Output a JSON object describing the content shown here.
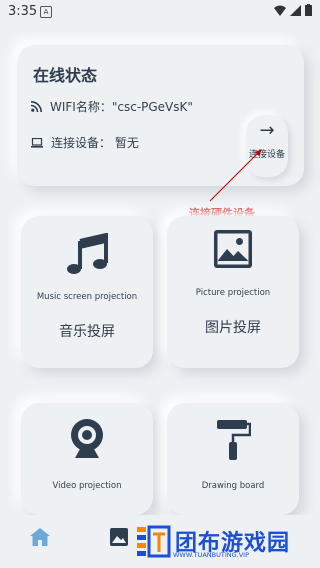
{
  "status_bar": {
    "time": "3:35",
    "app_icon": "A"
  },
  "status_card": {
    "title": "在线状态",
    "wifi_label": "WIFI名称：\"csc-PGeVsK\"",
    "device_label": "连接设备： 暂无",
    "connect_button": "连接设备"
  },
  "annotation": {
    "text": "连接硬件设备",
    "color": "#c40000"
  },
  "tiles": {
    "music": {
      "en": "Music screen projection",
      "cn": "音乐投屏"
    },
    "picture": {
      "en": "Picture projection",
      "cn": "图片投屏"
    },
    "video": {
      "en": "Video projection"
    },
    "drawing": {
      "en": "Drawing board"
    }
  },
  "watermark": {
    "text": "团布游戏园",
    "sub": "WWW.TUANBUTING.VIP"
  },
  "colors": {
    "background": "#eef1f4",
    "text": "#2f3e4e",
    "accent": "#6aa9d8",
    "watermark": "#1a4fd6"
  }
}
